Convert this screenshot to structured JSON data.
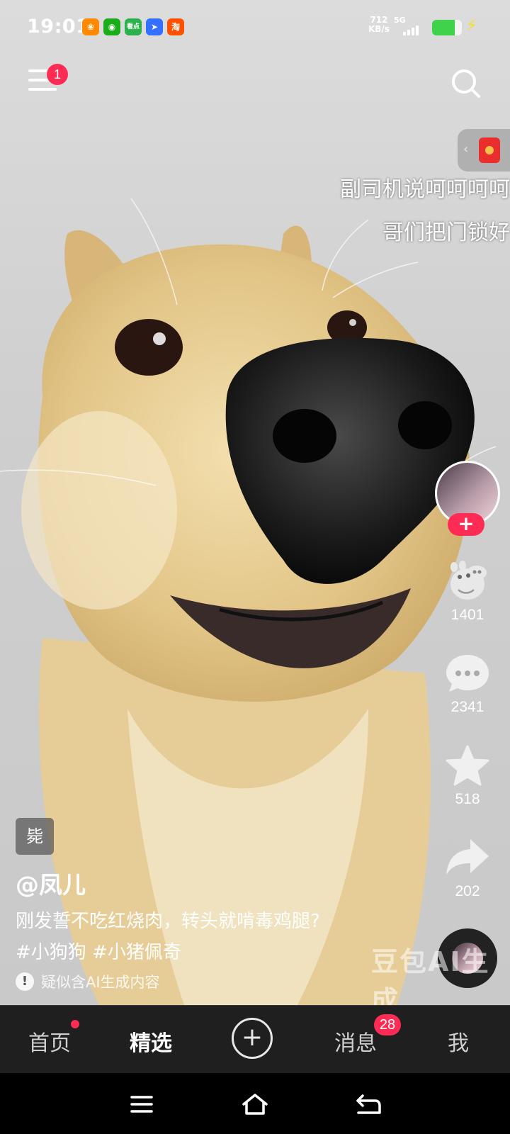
{
  "status_bar": {
    "time": "19:01",
    "apps": [
      {
        "icon": "meituan-app-icon",
        "glyph": "❀",
        "color": "#ff8a00"
      },
      {
        "icon": "wechat-app-icon",
        "glyph": "◉",
        "color": "#1aad19"
      },
      {
        "icon": "kandian-app-icon",
        "glyph": "看点",
        "color": "#2bb24c"
      },
      {
        "icon": "feishu-app-icon",
        "glyph": "➤",
        "color": "#3370ff"
      },
      {
        "icon": "taobao-app-icon",
        "glyph": "淘",
        "color": "#ff5000"
      }
    ],
    "net_speed_value": "712",
    "net_speed_unit": "KB/s",
    "network": "5G",
    "battery_level": 0.75
  },
  "top": {
    "menu_badge": "1"
  },
  "captions": {
    "line1": "副司机说呵呵呵呵",
    "line2": "哥们把门锁好"
  },
  "actions": {
    "likes": "1401",
    "comments": "2341",
    "favorites": "518",
    "shares": "202",
    "follow_symbol": "+"
  },
  "video_info": {
    "tag_chip": "毙",
    "username": "@凤儿",
    "description": "刚发誓不吃红烧肉，转头就啃毒鸡腿?",
    "hashtags": "#小狗狗 #小猪佩奇",
    "ai_notice": "疑似含AI生成内容",
    "watermark": "豆包AI生成"
  },
  "tabbar": {
    "home": "首页",
    "featured": "精选",
    "create": "+",
    "messages": "消息",
    "messages_badge": "28",
    "me": "我"
  }
}
